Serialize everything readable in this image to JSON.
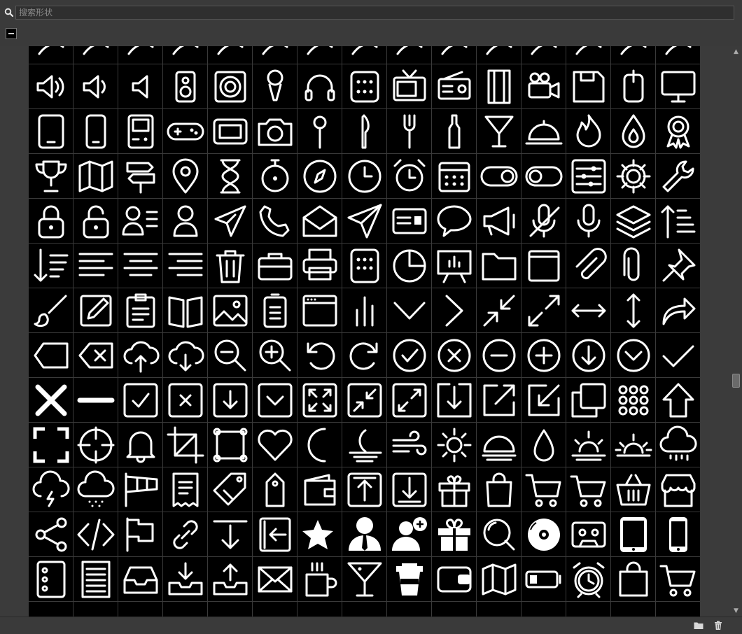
{
  "search": {
    "placeholder": "搜索形状",
    "value": ""
  },
  "toolbar": {
    "preset_thumb_icon": "preset-thumbnail-icon"
  },
  "colors": {
    "panel": "#3a3a3a",
    "cell": "#000000",
    "glyph": "#ffffff",
    "grid_line": "#3a3a3a"
  },
  "grid": {
    "columns": 15,
    "rows": [
      [
        "partial-shape-icon",
        "partial-shape-icon",
        "partial-shape-icon",
        "partial-shape-icon",
        "partial-shape-icon",
        "partial-shape-icon",
        "partial-shape-icon",
        "partial-shape-icon",
        "partial-shape-icon",
        "partial-shape-icon",
        "partial-shape-icon",
        "partial-shape-icon",
        "partial-shape-icon",
        "partial-shape-icon",
        "partial-shape-icon"
      ],
      [
        "volume-high-icon",
        "volume-low-icon",
        "volume-off-icon",
        "speaker-icon",
        "speaker-round-icon",
        "microphone-stand-icon",
        "headphones-icon",
        "keypad-icon",
        "tv-icon",
        "radio-icon",
        "film-icon",
        "video-camera-icon",
        "floppy-disk-icon",
        "mouse-icon",
        "monitor-icon"
      ],
      [
        "tablet-icon",
        "phone-icon",
        "gameboy-icon",
        "gamepad-icon",
        "console-icon",
        "camera-icon",
        "pin-icon",
        "knife-icon",
        "fork-icon",
        "bottle-icon",
        "cocktail-icon",
        "cloche-icon",
        "flame-icon",
        "drop-icon",
        "award-icon"
      ],
      [
        "trophy-icon",
        "map-icon",
        "signpost-icon",
        "location-pin-icon",
        "hourglass-icon",
        "stopwatch-icon",
        "compass-icon",
        "clock-icon",
        "alarm-clock-icon",
        "calendar-icon",
        "toggle-on-icon",
        "toggle-off-icon",
        "sliders-icon",
        "gear-icon",
        "wrench-icon"
      ],
      [
        "lock-icon",
        "unlock-icon",
        "user-list-icon",
        "user-icon",
        "airplane-icon",
        "phone-handset-icon",
        "envelope-open-icon",
        "paper-plane-icon",
        "id-card-icon",
        "speech-bubble-icon",
        "megaphone-icon",
        "mic-off-icon",
        "mic-icon",
        "layers-icon",
        "sort-up-icon"
      ],
      [
        "sort-down-icon",
        "align-left-icon",
        "align-center-icon",
        "align-right-icon",
        "trash-icon",
        "briefcase-icon",
        "printer-icon",
        "calculator-icon",
        "pie-chart-icon",
        "presentation-icon",
        "folder-icon",
        "frame-icon",
        "paperclip-diagonal-icon",
        "paperclip-icon",
        "pushpin-icon"
      ],
      [
        "brush-icon",
        "pencil-icon",
        "clipboard-icon",
        "book-open-icon",
        "image-icon",
        "battery-icon",
        "browser-window-icon",
        "bar-chart-icon",
        "chevron-down-icon",
        "chevron-right-icon",
        "collapse-icon",
        "expand-icon",
        "arrows-horizontal-icon",
        "arrows-vertical-icon",
        "redo-arrow-icon"
      ],
      [
        "tag-left-icon",
        "backspace-icon",
        "cloud-upload-icon",
        "cloud-download-icon",
        "zoom-out-icon",
        "zoom-in-icon",
        "rotate-left-icon",
        "rotate-right-icon",
        "check-circle-icon",
        "close-circle-icon",
        "minus-circle-icon",
        "plus-circle-icon",
        "arrow-down-circle-icon",
        "chevron-down-circle-icon",
        "checkmark-icon"
      ],
      [
        "close-icon",
        "minus-icon",
        "check-square-icon",
        "close-square-icon",
        "arrow-down-square-icon",
        "chevron-down-square-icon",
        "fullscreen-icon",
        "collapse-square-icon",
        "expand-square-icon",
        "download-square-icon",
        "external-link-icon",
        "arrow-down-left-square-icon",
        "copy-icon",
        "dots-grid-icon",
        "home-arrow-icon"
      ],
      [
        "focus-frame-icon",
        "crosshair-icon",
        "bell-icon",
        "crop-icon",
        "selection-box-icon",
        "heart-icon",
        "moon-icon",
        "moon-fog-icon",
        "wind-icon",
        "sun-icon",
        "sunrise-icon",
        "raindrop-icon",
        "sunset-icon",
        "sun-horizon-icon",
        "cloud-rain-icon"
      ],
      [
        "thunderstorm-icon",
        "cloud-snow-icon",
        "windsock-icon",
        "receipt-icon",
        "tag-icon",
        "price-tag-icon",
        "wallet-icon",
        "upload-box-icon",
        "download-box-icon",
        "gift-icon",
        "shopping-bag-icon",
        "cart-full-icon",
        "cart-icon",
        "basket-icon",
        "store-icon"
      ],
      [
        "share-icon",
        "code-icon",
        "flag-icon",
        "link-icon",
        "download-arrow-icon",
        "sign-in-icon",
        "star-burst-icon",
        "businessman-icon",
        "add-user-icon",
        "gift-box-icon",
        "search-ring-icon",
        "disc-icon",
        "cassette-icon",
        "tablet-device-icon",
        "phone-device-icon"
      ],
      [
        "server-icon",
        "document-lines-icon",
        "inbox-icon",
        "inbox-download-icon",
        "inbox-upload-icon",
        "mail-icon",
        "coffee-mug-icon",
        "martini-icon",
        "coffee-cup-icon",
        "wallet-card-icon",
        "folded-map-icon",
        "battery-low-icon",
        "alarm-icon",
        "bag-icon",
        "shopping-cart-icon"
      ],
      [
        "partial-shape-icon",
        "partial-shape-icon",
        "partial-shape-icon",
        "partial-shape-icon",
        "partial-shape-icon",
        "partial-shape-icon",
        "partial-shape-icon",
        "partial-shape-icon",
        "partial-shape-icon",
        "partial-shape-icon",
        "partial-shape-icon",
        "partial-shape-icon",
        "partial-shape-icon",
        "partial-shape-icon",
        "partial-shape-icon"
      ]
    ]
  },
  "footer": {
    "new_folder_icon": "new-folder-icon",
    "delete_icon": "trash-icon"
  }
}
